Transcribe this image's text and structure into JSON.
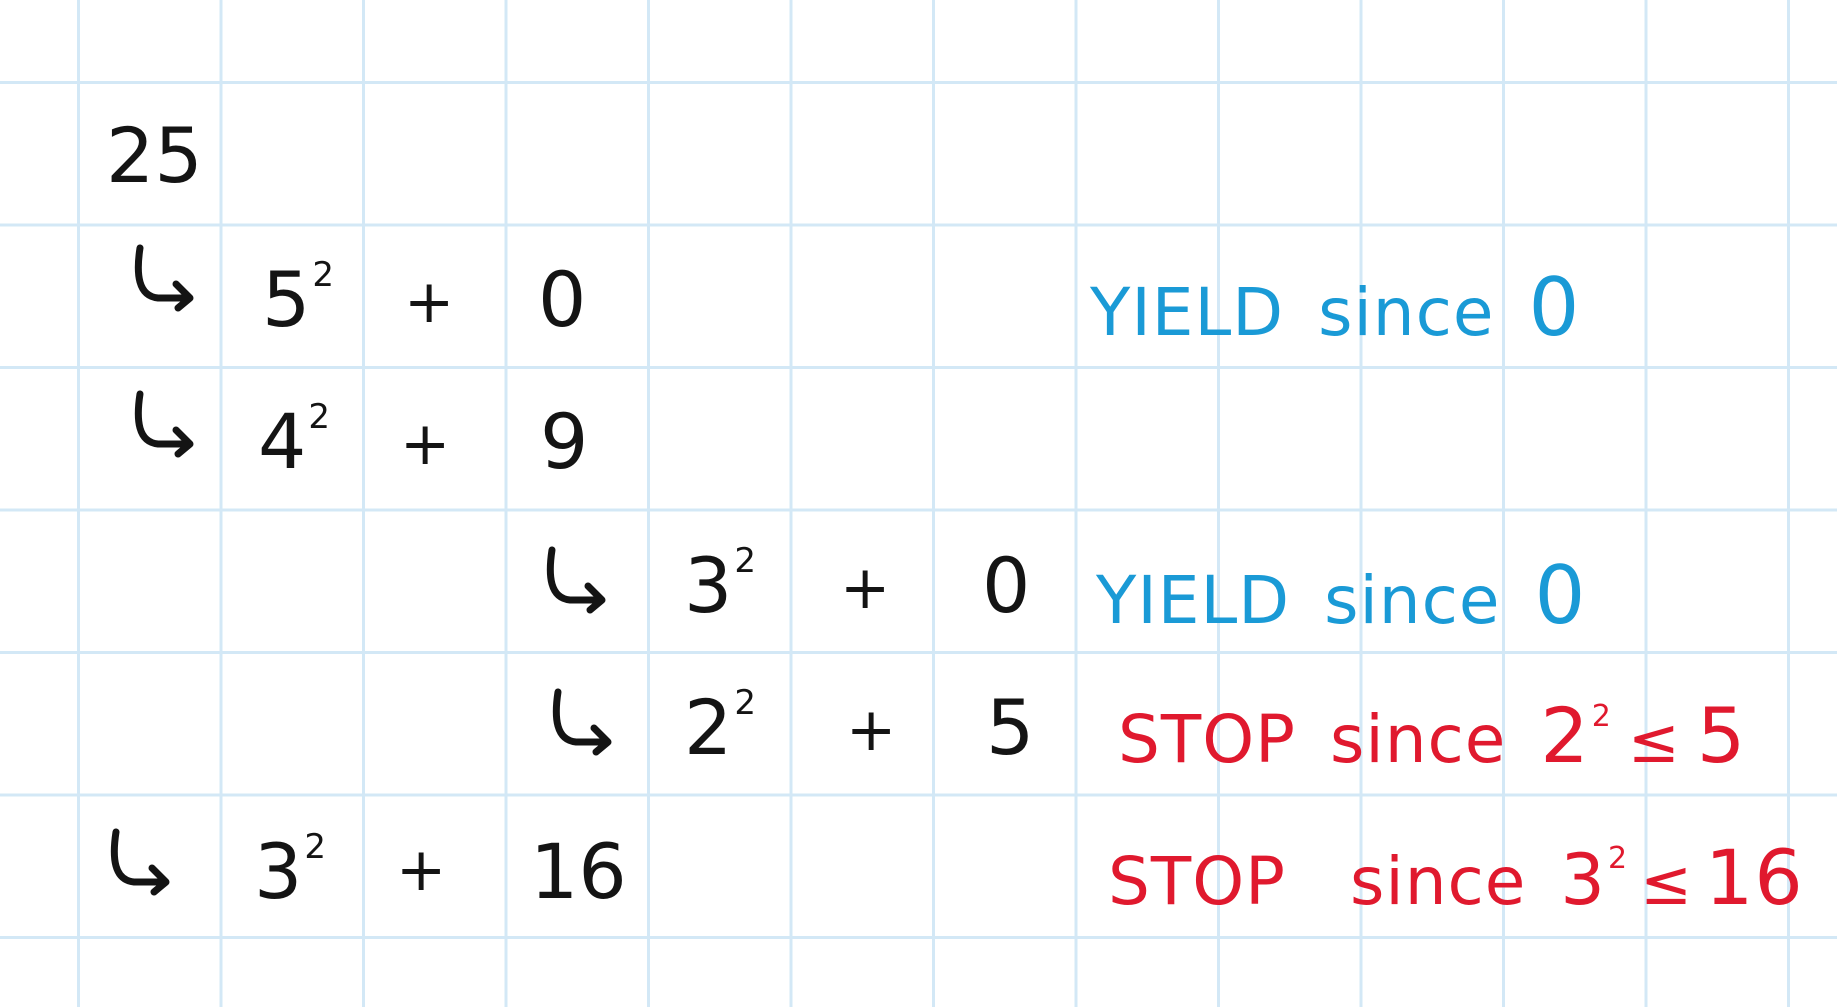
{
  "document": {
    "type": "handwritten-grid-notes",
    "ink_colors": {
      "default": "#141414",
      "yield": "#1a9ad6",
      "stop": "#e0192e"
    },
    "grid_color": "#d3e8f6",
    "root": "25",
    "rows": [
      {
        "base": "5",
        "exponent": "2",
        "operator": "+",
        "remainder": "0",
        "note": {
          "verdict": "YIELD",
          "word": "since",
          "reason": "0"
        }
      },
      {
        "base": "4",
        "exponent": "2",
        "operator": "+",
        "remainder": "9"
      },
      {
        "base": "3",
        "exponent": "2",
        "operator": "+",
        "remainder": "0",
        "note": {
          "verdict": "YIELD",
          "word": "since",
          "reason": "0"
        }
      },
      {
        "base": "2",
        "exponent": "2",
        "operator": "+",
        "remainder": "5",
        "note": {
          "verdict": "STOP",
          "word": "since",
          "reason_base": "2",
          "reason_exponent": "2",
          "relation": "≤",
          "reason_rhs": "5"
        }
      },
      {
        "base": "3",
        "exponent": "2",
        "operator": "+",
        "remainder": "16",
        "note": {
          "verdict": "STOP",
          "word": "since",
          "reason_base": "3",
          "reason_exponent": "2",
          "relation": "≤",
          "reason_rhs": "16"
        }
      }
    ]
  }
}
